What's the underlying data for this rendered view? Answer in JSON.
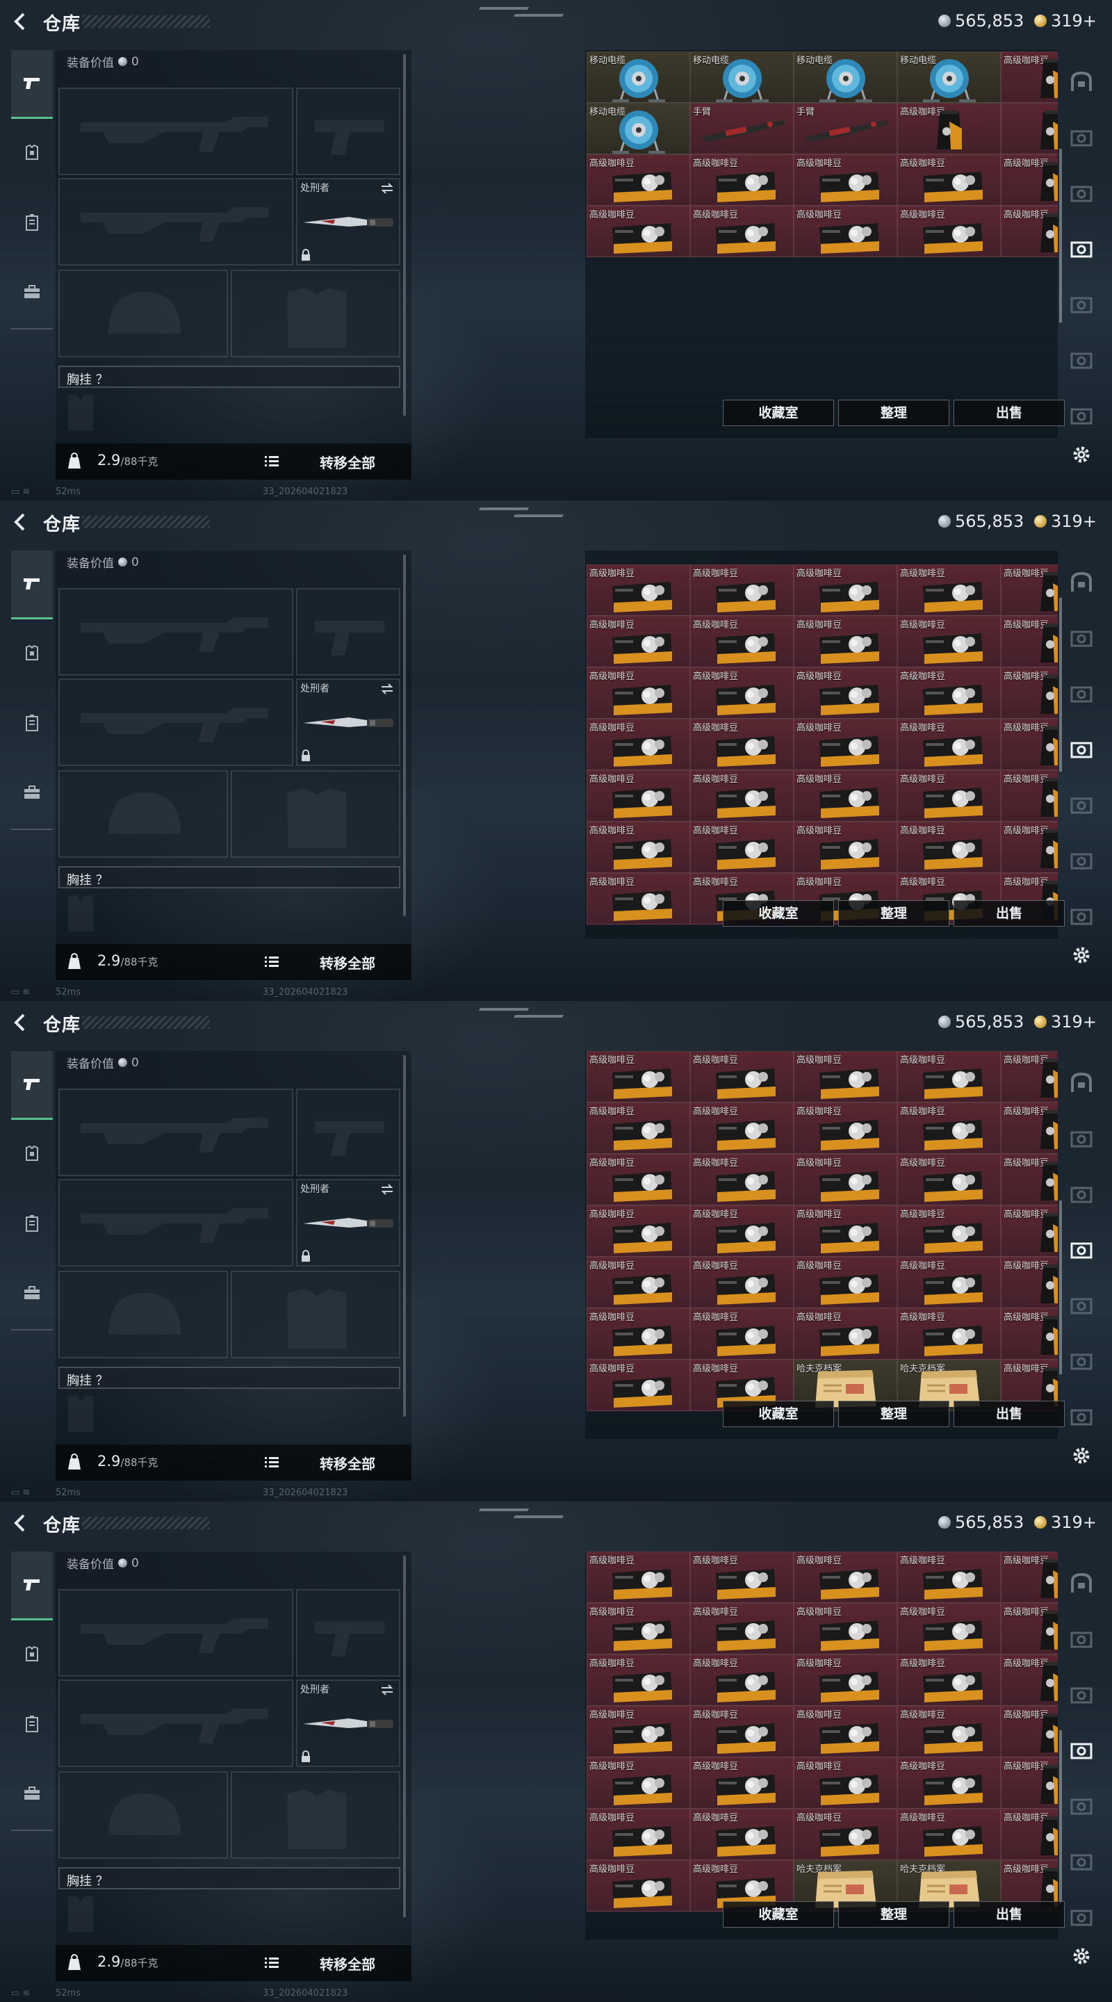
{
  "screen": {
    "title": "仓库",
    "currency_silver": "565,853",
    "currency_gold": "319+",
    "equip_value_label": "装备价值",
    "equip_value": "0",
    "melee_name": "处刑者",
    "chest_rig_label": "胸挂 ？",
    "weight_value": "2.9",
    "weight_max": "/88千克",
    "transfer_all": "转移全部",
    "ping": "52ms",
    "build": "33_202604021823",
    "buttons": {
      "collection": "收藏室",
      "sort": "整理",
      "sell": "出售"
    }
  },
  "item_names": {
    "cable": "移动电缆",
    "arm": "手臂",
    "coffee": "高级咖啡豆",
    "file": "哈夫克档案"
  },
  "frames": [
    {
      "scroll_fraction": 0.35,
      "grid": [
        [
          "cable",
          "cable",
          "cable",
          "cable",
          "coffee_bag"
        ],
        [
          "cable",
          "arm",
          "arm",
          "coffee_bag",
          "coffee_bag2"
        ],
        [
          "coffee",
          "coffee",
          "coffee",
          "coffee",
          "coffee_bag"
        ],
        [
          "coffee",
          "coffee",
          "coffee",
          "coffee",
          "coffee_bag"
        ],
        [
          "empty",
          "empty",
          "empty",
          "empty",
          "empty"
        ]
      ]
    },
    {
      "scroll_fraction": 0.0,
      "grid": [
        [
          "coffee",
          "coffee",
          "coffee",
          "coffee",
          "coffee_bag"
        ],
        [
          "coffee",
          "coffee",
          "coffee",
          "coffee",
          "coffee_bag"
        ],
        [
          "coffee",
          "coffee",
          "coffee",
          "coffee",
          "coffee_bag"
        ],
        [
          "coffee",
          "coffee",
          "coffee",
          "coffee",
          "coffee_bag"
        ],
        [
          "coffee",
          "coffee",
          "coffee",
          "coffee",
          "coffee_bag"
        ],
        [
          "coffee",
          "coffee",
          "coffee",
          "coffee",
          "coffee_bag"
        ],
        [
          "coffee",
          "coffee",
          "coffee",
          "coffee",
          "coffee_bag"
        ]
      ]
    },
    {
      "scroll_fraction": 0.7,
      "grid": [
        [
          "coffee",
          "coffee",
          "coffee",
          "coffee",
          "coffee_bag"
        ],
        [
          "coffee",
          "coffee",
          "coffee",
          "coffee",
          "coffee_bag"
        ],
        [
          "coffee",
          "coffee",
          "coffee",
          "coffee",
          "coffee_bag"
        ],
        [
          "coffee",
          "coffee",
          "coffee",
          "coffee",
          "coffee_bag"
        ],
        [
          "coffee",
          "coffee",
          "coffee",
          "coffee",
          "coffee_bag"
        ],
        [
          "coffee",
          "coffee",
          "coffee",
          "coffee",
          "coffee_bag"
        ],
        [
          "coffee",
          "coffee",
          "file",
          "file",
          "coffee_bag"
        ]
      ]
    },
    {
      "scroll_fraction": 0.9,
      "grid": [
        [
          "coffee",
          "coffee",
          "coffee",
          "coffee",
          "coffee_bag"
        ],
        [
          "coffee",
          "coffee",
          "coffee",
          "coffee",
          "coffee_bag"
        ],
        [
          "coffee",
          "coffee",
          "coffee",
          "coffee",
          "coffee_bag"
        ],
        [
          "coffee",
          "coffee",
          "coffee",
          "coffee",
          "coffee_bag"
        ],
        [
          "coffee",
          "coffee",
          "coffee",
          "coffee",
          "coffee_bag"
        ],
        [
          "coffee",
          "coffee",
          "coffee",
          "coffee",
          "coffee_bag"
        ],
        [
          "coffee",
          "coffee",
          "file",
          "file",
          "coffee_bag"
        ]
      ]
    }
  ],
  "colors": {
    "accent": "#5bc08f",
    "cell_maroon": "#5a2630",
    "cell_gold": "#3d3a2c"
  }
}
